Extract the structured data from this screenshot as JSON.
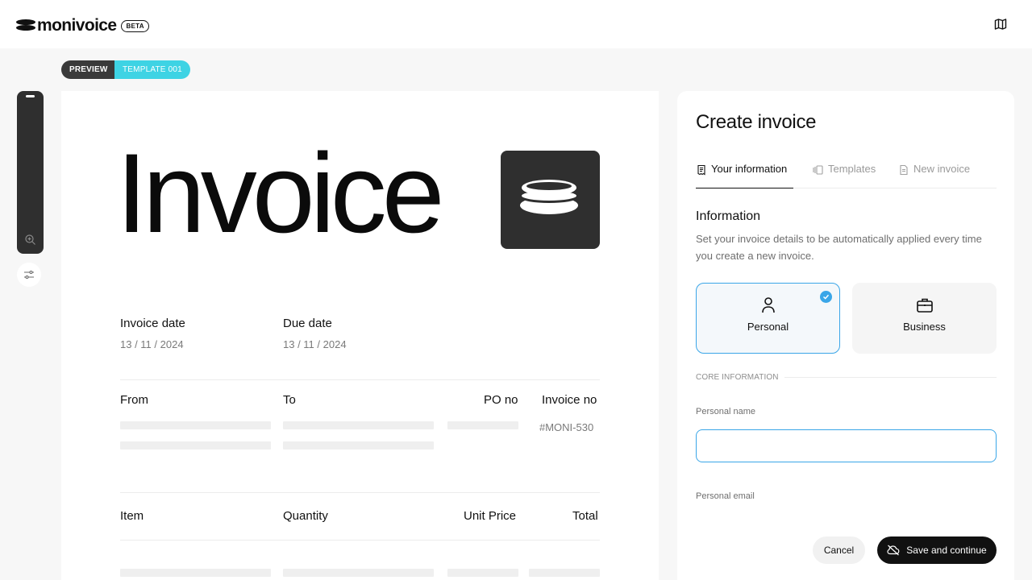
{
  "app": {
    "brand": "monivoice",
    "badge": "BETA"
  },
  "header": {
    "map_icon": "map-icon"
  },
  "preview_bar": {
    "preview_label": "PREVIEW",
    "template_label": "TEMPLATE 001",
    "template_color": "#3ed3e4"
  },
  "invoice": {
    "title": "Invoice",
    "invoice_date_label": "Invoice date",
    "invoice_date_value": "13 / 11 / 2024",
    "due_date_label": "Due date",
    "due_date_value": "13 / 11 / 2024",
    "from_label": "From",
    "to_label": "To",
    "po_label": "PO no",
    "invoice_no_label": "Invoice no",
    "invoice_no_value": "#MONI-530",
    "columns": [
      "Item",
      "Quantity",
      "Unit Price",
      "Total"
    ]
  },
  "panel": {
    "title": "Create invoice",
    "tabs": [
      {
        "label": "Your information",
        "icon": "receipt-icon",
        "active": true
      },
      {
        "label": "Templates",
        "icon": "templates-icon",
        "active": false
      },
      {
        "label": "New invoice",
        "icon": "document-icon",
        "active": false
      }
    ],
    "section_title": "Information",
    "section_desc": "Set your invoice details to be automatically applied every time you create a new invoice.",
    "types": [
      {
        "label": "Personal",
        "icon": "user-icon",
        "selected": true
      },
      {
        "label": "Business",
        "icon": "briefcase-icon",
        "selected": false
      }
    ],
    "core_label": "CORE INFORMATION",
    "personal_name_label": "Personal name",
    "personal_name_value": "",
    "personal_email_label": "Personal email",
    "cancel_label": "Cancel",
    "save_label": "Save and continue",
    "accent_color": "#3aa6e8"
  }
}
